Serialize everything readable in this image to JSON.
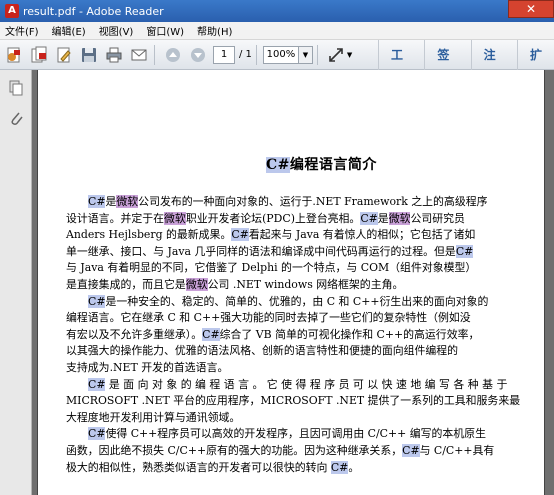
{
  "window": {
    "title": "result.pdf - Adobe Reader",
    "close_glyph": "✕"
  },
  "menu": [
    "文件(F)",
    "编辑(E)",
    "视图(V)",
    "窗口(W)",
    "帮助(H)"
  ],
  "toolbar": {
    "page_current": "1",
    "page_total": "/ 1",
    "zoom": "100%",
    "tasks": [
      "工具",
      "签名",
      "注释",
      "扩"
    ],
    "icons": [
      "create-pdf-icon",
      "combine-pdf-icon",
      "edit-icon",
      "save-icon",
      "print-icon",
      "email-icon",
      "previous-page-icon",
      "next-page-icon",
      "fit-page-icon"
    ]
  },
  "nav_icons": [
    "pages-icon",
    "attachments-icon"
  ],
  "document": {
    "title_hl": "C#",
    "title_rest": "编程语言简介",
    "lines": [
      [
        [
          "hl",
          "C#"
        ],
        [
          "",
          "是"
        ],
        [
          "hlp",
          "微软"
        ],
        [
          "",
          "公司发布的一种面向对象的、运行于.NET Framework 之上的高级程序"
        ]
      ],
      [
        [
          "",
          "设计语言。并定于在"
        ],
        [
          "hlp",
          "微软"
        ],
        [
          "",
          "职业开发者论坛(PDC)上登台亮相。"
        ],
        [
          "hl",
          "C#"
        ],
        [
          "",
          "是"
        ],
        [
          "hlp",
          "微软"
        ],
        [
          "",
          "公司研究员"
        ]
      ],
      [
        [
          "",
          "Anders  Hejlsberg 的最新成果。"
        ],
        [
          "hl",
          "C#"
        ],
        [
          "",
          "看起来与 Java 有着惊人的相似；它包括了诸如"
        ]
      ],
      [
        [
          "",
          "单一继承、接口、与 Java 几乎同样的语法和编译成中间代码再运行的过程。但是"
        ],
        [
          "hl",
          "C#"
        ]
      ],
      [
        [
          "",
          "与 Java 有着明显的不同，它借鉴了 Delphi 的一个特点，与 COM（组件对象模型）"
        ]
      ],
      [
        [
          "",
          "是直接集成的，而且它是"
        ],
        [
          "hlp",
          "微软"
        ],
        [
          "",
          "公司 .NET windows 网络框架的主角。"
        ]
      ],
      [
        [
          "ind",
          ""
        ],
        [
          "hl",
          "C#"
        ],
        [
          "",
          "是一种安全的、稳定的、简单的、优雅的，由 C 和 C++衍生出来的面向对象的"
        ]
      ],
      [
        [
          "",
          "编程语言。它在继承 C 和 C++强大功能的同时去掉了一些它们的复杂特性（例如没"
        ]
      ],
      [
        [
          "",
          "有宏以及不允许多重继承）。"
        ],
        [
          "hl",
          "C#"
        ],
        [
          "",
          "综合了 VB 简单的可视化操作和 C++的高运行效率，"
        ]
      ],
      [
        [
          "",
          "以其强大的操作能力、优雅的语法风格、创新的语言特性和便捷的面向组件编程的"
        ]
      ],
      [
        [
          "",
          "支持成为.NET 开发的首选语言。"
        ]
      ],
      [
        [
          "ind",
          ""
        ],
        [
          "hl",
          "C#"
        ],
        [
          "",
          " 是 面 向 对 象 的 编 程 语 言 。 它 使 得 程 序 员 可 以 快 速 地 编 写 各 种 基 于"
        ]
      ],
      [
        [
          "",
          "MICROSOFT .NET 平台的应用程序，MICROSOFT .NET 提供了一系列的工具和服务来最"
        ]
      ],
      [
        [
          "",
          "大程度地开发利用计算与通讯领域。"
        ]
      ],
      [
        [
          "ind",
          ""
        ],
        [
          "hl",
          "C#"
        ],
        [
          "",
          "使得 C++程序员可以高效的开发程序，且因可调用由 C/C++ 编写的本机原生"
        ]
      ],
      [
        [
          "",
          "函数，因此绝不损失 C/C++原有的强大的功能。因为这种继承关系，"
        ],
        [
          "hl",
          "C#"
        ],
        [
          "",
          "与 C/C++具有"
        ]
      ],
      [
        [
          "",
          "极大的相似性，熟悉类似语言的开发者可以很快的转向 "
        ],
        [
          "hl",
          "C#"
        ],
        [
          "",
          "。"
        ]
      ]
    ]
  }
}
